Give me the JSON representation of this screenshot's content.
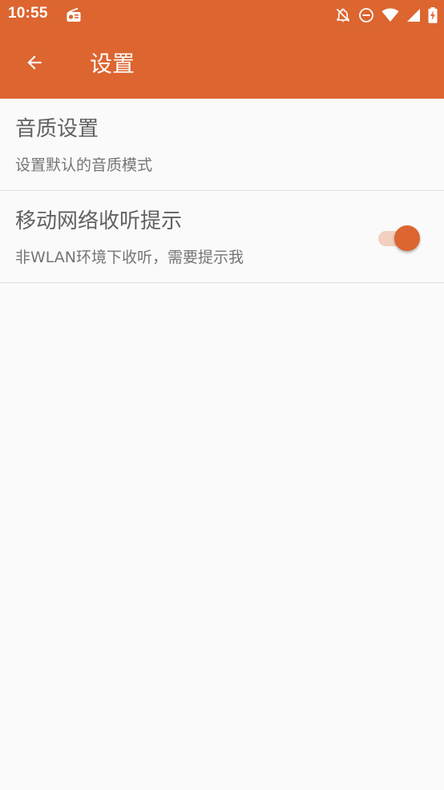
{
  "status_bar": {
    "time": "10:55",
    "icons": [
      "radio-icon",
      "notifications-off-icon",
      "do-not-disturb-icon",
      "wifi-icon",
      "cell-signal-icon",
      "battery-charging-icon"
    ]
  },
  "toolbar": {
    "back_icon": "arrow-back-icon",
    "title": "设置"
  },
  "settings": [
    {
      "title": "音质设置",
      "summary": "设置默认的音质模式"
    },
    {
      "title": "移动网络收听提示",
      "summary": "非WLAN环境下收听，需要提示我",
      "switch_on": true
    }
  ],
  "colors": {
    "primary": "#dc6530",
    "switch_track": "#f2cfbf",
    "background": "#fafafa",
    "title_text": "#616161",
    "summary_text": "#757575"
  }
}
